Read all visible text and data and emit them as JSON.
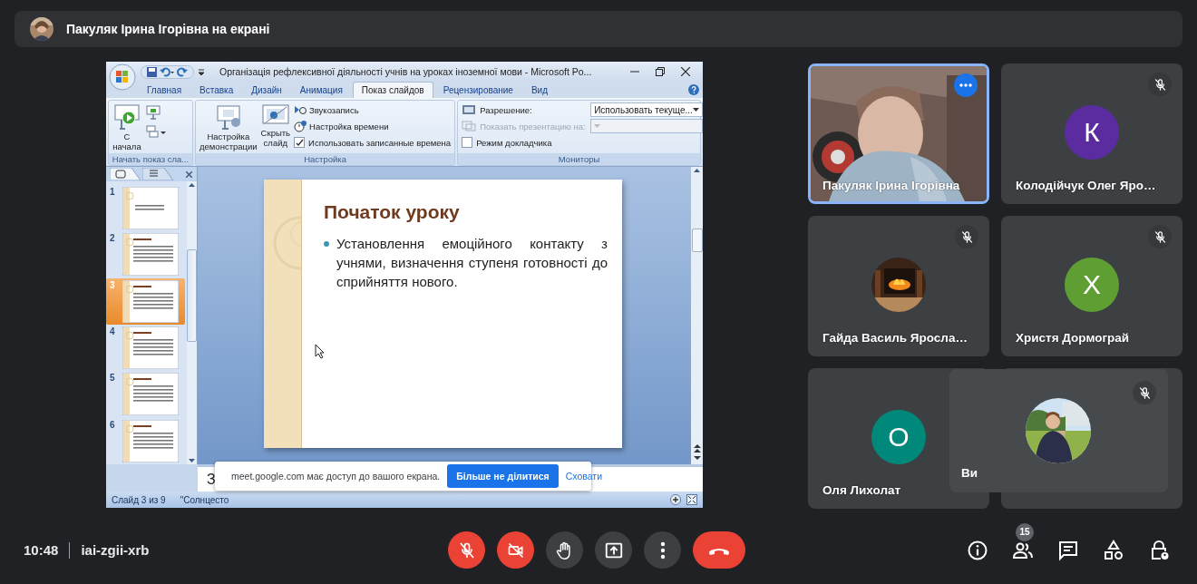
{
  "banner": {
    "text": "Пакуляк Ірина Ігорівна на екрані"
  },
  "presentation_window": {
    "title": "Організація рефлексивної діяльності учнів на уроках іноземної мови - Microsoft Po...",
    "tabs": [
      {
        "label": "Главная",
        "selected": false
      },
      {
        "label": "Вставка",
        "selected": false
      },
      {
        "label": "Дизайн",
        "selected": false
      },
      {
        "label": "Анимация",
        "selected": false
      },
      {
        "label": "Показ слайдов",
        "selected": true
      },
      {
        "label": "Рецензирование",
        "selected": false
      },
      {
        "label": "Вид",
        "selected": false
      }
    ],
    "ribbon_groups": [
      {
        "label": "Начать показ сла...",
        "controls": [
          {
            "kind": "large_button",
            "label": "С начала"
          },
          {
            "kind": "icon_button"
          },
          {
            "kind": "icon_button"
          }
        ]
      },
      {
        "label": "Настройка",
        "controls": [
          {
            "kind": "large_button",
            "label": "Настройка демонстрации"
          },
          {
            "kind": "large_button",
            "label": "Скрыть слайд"
          },
          {
            "kind": "small_button",
            "label": "Звукозапись"
          },
          {
            "kind": "small_button",
            "label": "Настройка времени"
          },
          {
            "kind": "checkbox",
            "label": "Использовать записанные времена",
            "checked": true
          }
        ]
      },
      {
        "label": "Мониторы",
        "controls": [
          {
            "kind": "dropdown",
            "label": "Разрешение:",
            "value": "Использовать текуще...",
            "disabled": false
          },
          {
            "kind": "dropdown",
            "label": "Показать презентацию на:",
            "disabled": true
          },
          {
            "kind": "checkbox",
            "label": "Режим докладчика",
            "checked": false
          }
        ]
      }
    ],
    "slides": [
      {
        "number": "1",
        "selected": false
      },
      {
        "number": "2",
        "selected": false
      },
      {
        "number": "3",
        "selected": true
      },
      {
        "number": "4",
        "selected": false
      },
      {
        "number": "5",
        "selected": false
      },
      {
        "number": "6",
        "selected": false
      }
    ],
    "current_slide": {
      "title": "Початок уроку",
      "bullet": "Установлення емоційного контакту з учнями, визначення ступеня готовності до сприйняття нового."
    },
    "notes_text": "З",
    "status_bar": [
      "Слайд 3 из 9",
      "\"Солнцесто"
    ]
  },
  "share_notice": {
    "text": "meet.google.com має доступ до вашого екрана.",
    "stop_button": "Більше не ділитися",
    "hide_link": "Сховати"
  },
  "participants": [
    {
      "name": "Пакуляк Ірина Ігорівна",
      "kind": "video",
      "muted": false,
      "highlighted": true
    },
    {
      "name": "Колодійчук Олег Яро…",
      "kind": "initial",
      "initial": "К",
      "color": "#5a2ca0",
      "muted": true
    },
    {
      "name": "Гайда Василь Яросла…",
      "muted": true
    },
    {
      "name": "Христя Дормограй",
      "kind": "initial",
      "initial": "Х",
      "color": "#5f9e33",
      "muted": true
    },
    {
      "name": "Оля Лихолат",
      "kind": "initial",
      "initial": "О",
      "color": "#00897b"
    }
  ],
  "self_tile": {
    "name": "Ви",
    "muted": true
  },
  "meeting": {
    "time": "10:48",
    "code": "iai-zgii-xrb"
  },
  "controls": [
    {
      "kind": "mic",
      "off": true
    },
    {
      "kind": "camera",
      "off": true
    },
    {
      "kind": "hand",
      "off": false
    },
    {
      "kind": "present",
      "off": false
    },
    {
      "kind": "more",
      "off": false
    },
    {
      "kind": "leave"
    }
  ],
  "side_icons": [
    {
      "kind": "info"
    },
    {
      "kind": "people",
      "badge": "15"
    },
    {
      "kind": "chat"
    },
    {
      "kind": "activities"
    },
    {
      "kind": "host"
    }
  ]
}
